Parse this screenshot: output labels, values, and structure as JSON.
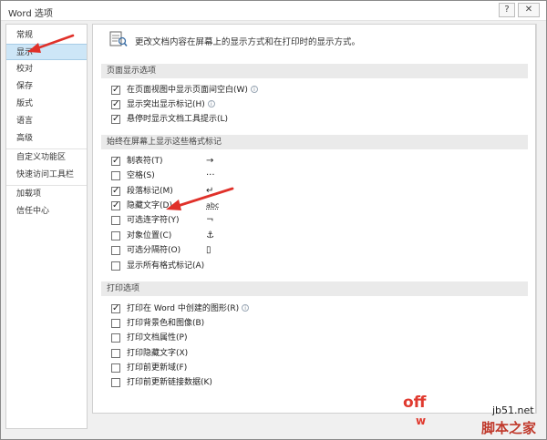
{
  "window": {
    "title": "Word 选项",
    "help_glyph": "?",
    "close_glyph": "✕"
  },
  "sidebar": {
    "items": [
      {
        "label": "常规"
      },
      {
        "label": "显示"
      },
      {
        "label": "校对"
      },
      {
        "label": "保存"
      },
      {
        "label": "版式"
      },
      {
        "label": "语言"
      },
      {
        "label": "高级"
      },
      {
        "label": "自定义功能区"
      },
      {
        "label": "快速访问工具栏"
      },
      {
        "label": "加载项"
      },
      {
        "label": "信任中心"
      }
    ],
    "selected": "显示"
  },
  "header": {
    "text": "更改文档内容在屏幕上的显示方式和在打印时的显示方式。"
  },
  "sections": {
    "page_display": {
      "title": "页面显示选项",
      "options": [
        {
          "label": "在页面视图中显示页面间空白(W)",
          "checked": true,
          "info": true
        },
        {
          "label": "显示突出显示标记(H)",
          "checked": true,
          "info": true
        },
        {
          "label": "悬停时显示文档工具提示(L)",
          "checked": true,
          "info": false
        }
      ]
    },
    "format_marks": {
      "title": "始终在屏幕上显示这些格式标记",
      "options": [
        {
          "label": "制表符(T)",
          "checked": true,
          "glyph": "→"
        },
        {
          "label": "空格(S)",
          "checked": false,
          "glyph": "···"
        },
        {
          "label": "段落标记(M)",
          "checked": true,
          "glyph": "↵"
        },
        {
          "label": "隐藏文字(D)",
          "checked": true,
          "glyph": "abc"
        },
        {
          "label": "可选连字符(Y)",
          "checked": false,
          "glyph": "¬"
        },
        {
          "label": "对象位置(C)",
          "checked": false,
          "glyph": "⚓"
        },
        {
          "label": "可选分隔符(O)",
          "checked": false,
          "glyph": "▯"
        },
        {
          "label": "显示所有格式标记(A)",
          "checked": false,
          "glyph": ""
        }
      ]
    },
    "print": {
      "title": "打印选项",
      "options": [
        {
          "label": "打印在 Word 中创建的图形(R)",
          "checked": true,
          "info": true
        },
        {
          "label": "打印背景色和图像(B)",
          "checked": false,
          "info": false
        },
        {
          "label": "打印文档属性(P)",
          "checked": false,
          "info": false
        },
        {
          "label": "打印隐藏文字(X)",
          "checked": false,
          "info": false
        },
        {
          "label": "打印前更新域(F)",
          "checked": false,
          "info": false
        },
        {
          "label": "打印前更新链接数据(K)",
          "checked": false,
          "info": false
        }
      ]
    }
  },
  "info_glyph": "i",
  "watermark": {
    "off": "off",
    "w": "w",
    "site": "jb51.net",
    "brand": "脚本之家"
  },
  "colors": {
    "sidebar_selected": "#cde6f7",
    "section_bg": "#eaeaea",
    "annotation_arrow": "#e0312a"
  }
}
